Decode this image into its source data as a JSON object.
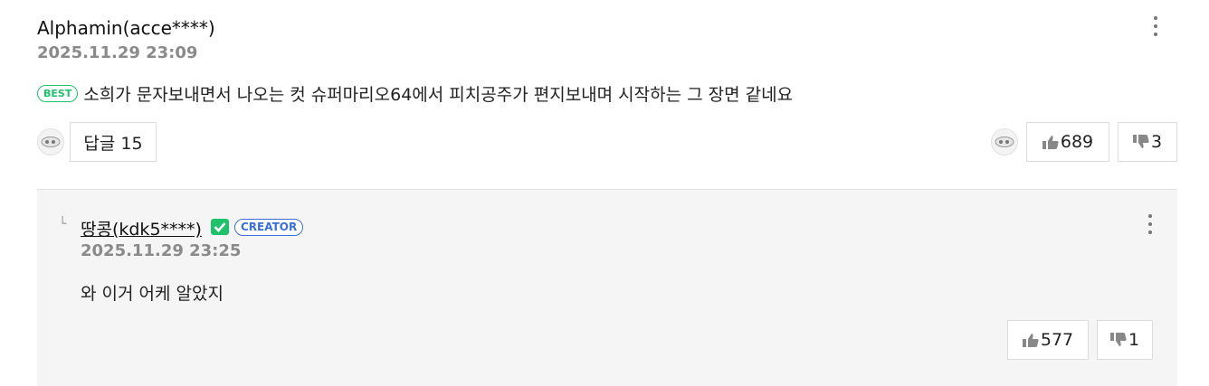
{
  "comment": {
    "author": "Alphamin(acce****)",
    "date": "2025.11.29 23:09",
    "badge": "BEST",
    "text": "소희가 문자보내면서 나오는 컷 슈퍼마리오64에서 피치공주가 편지보내며 시작하는 그 장면 같네요",
    "reply_button": "답글 15",
    "likes": "689",
    "dislikes": "3"
  },
  "reply": {
    "mark": "└",
    "author": "땅콩(kdk5****)",
    "creator_badge": "CREATOR",
    "date": "2025.11.29 23:25",
    "text": "와 이거 어케 알았지",
    "likes": "577",
    "dislikes": "1"
  },
  "colors": {
    "best_green": "#1fc16b",
    "creator_blue": "#3a6fd8",
    "reply_bg": "#f5f5f5"
  }
}
